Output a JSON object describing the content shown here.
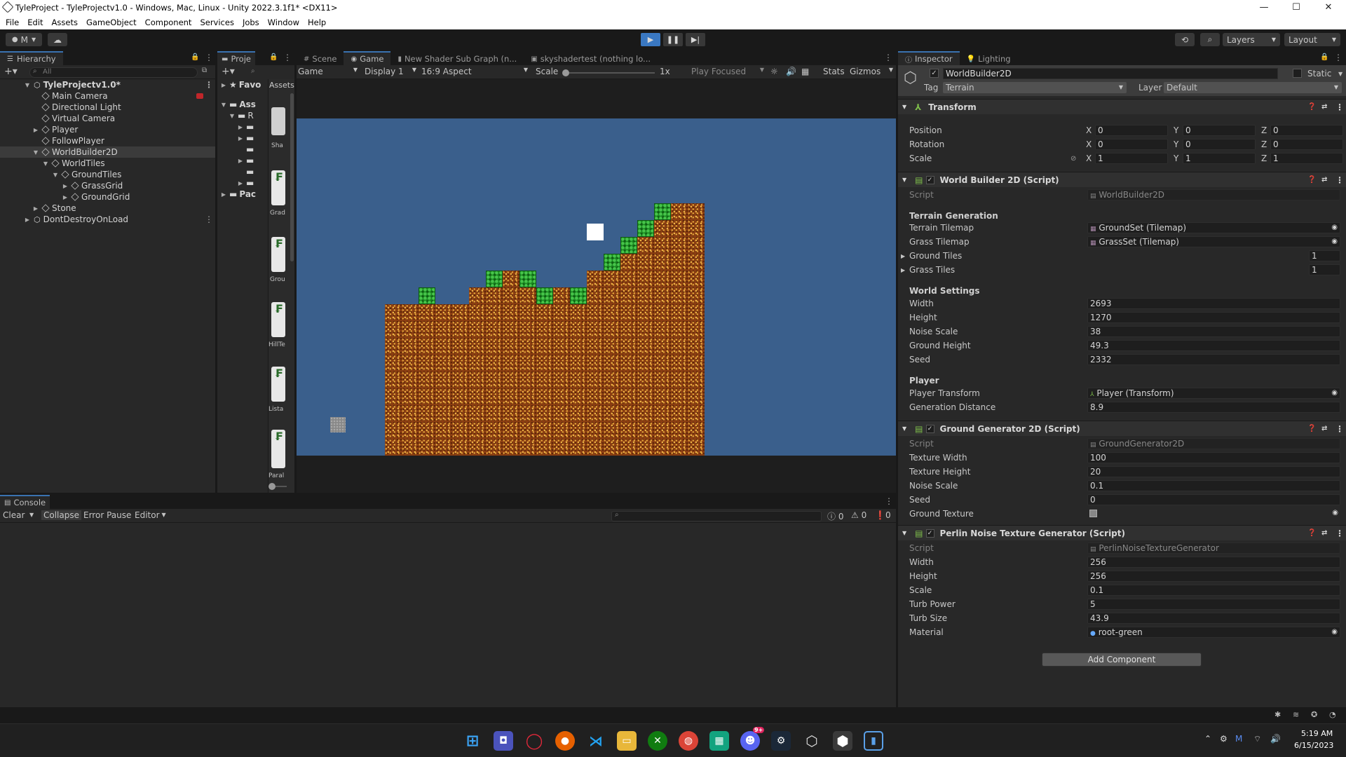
{
  "window": {
    "title": "TyleProject - TyleProjectv1.0 - Windows, Mac, Linux - Unity 2022.3.1f1* <DX11>",
    "min": "—",
    "max": "☐",
    "close": "✕"
  },
  "menu": [
    "File",
    "Edit",
    "Assets",
    "GameObject",
    "Component",
    "Services",
    "Jobs",
    "Window",
    "Help"
  ],
  "toolbar": {
    "account": "M",
    "layers": "Layers",
    "layout": "Layout"
  },
  "hierarchy": {
    "tab": "Hierarchy",
    "search_placeholder": "All",
    "items": [
      {
        "label": "TyleProjectv1.0*",
        "bold": true
      },
      {
        "label": "Main Camera"
      },
      {
        "label": "Directional Light"
      },
      {
        "label": "Virtual Camera"
      },
      {
        "label": "Player"
      },
      {
        "label": "FollowPlayer"
      },
      {
        "label": "WorldBuilder2D"
      },
      {
        "label": "WorldTiles"
      },
      {
        "label": "GroundTiles"
      },
      {
        "label": "GrassGrid"
      },
      {
        "label": "GroundGrid"
      },
      {
        "label": "Stone"
      },
      {
        "label": "DontDestroyOnLoad"
      }
    ]
  },
  "project": {
    "tab": "Proje",
    "favorites": "Favo",
    "assets": "Ass",
    "root": "R",
    "packages": "Pac",
    "assets_header": "Assets",
    "thumbs": [
      "Sha",
      "Grad",
      "Grou",
      "HillTe",
      "Lista",
      "Paral"
    ]
  },
  "game_view": {
    "tabs": [
      "Scene",
      "Game",
      "New Shader Sub Graph (n...",
      "skyshadertest (nothing lo..."
    ],
    "game_dropdown": "Game",
    "display": "Display 1",
    "aspect": "16:9 Aspect",
    "scale_label": "Scale",
    "scale_value": "1x",
    "play_mode": "Play Focused",
    "stats": "Stats",
    "gizmos": "Gizmos",
    "colors": {
      "sky": "#3a5f8c",
      "dirt": "#8b3e12",
      "grass": "#1c8a22"
    }
  },
  "console": {
    "tab": "Console",
    "clear": "Clear",
    "collapse": "Collapse",
    "error_pause": "Error Pause",
    "editor": "Editor",
    "log_count": "0",
    "warn_count": "0",
    "error_count": "0"
  },
  "inspector": {
    "tabs": [
      "Inspector",
      "Lighting"
    ],
    "object_name": "WorldBuilder2D",
    "static": "Static",
    "tag_label": "Tag",
    "tag_value": "Terrain",
    "layer_label": "Layer",
    "layer_value": "Default",
    "transform": {
      "title": "Transform",
      "position": {
        "label": "Position",
        "x": "0",
        "y": "0",
        "z": "0"
      },
      "rotation": {
        "label": "Rotation",
        "x": "0",
        "y": "0",
        "z": "0"
      },
      "scale": {
        "label": "Scale",
        "x": "1",
        "y": "1",
        "z": "1"
      }
    },
    "world_builder": {
      "title": "World Builder 2D (Script)",
      "script_label": "Script",
      "script_value": "WorldBuilder2D",
      "terrain_section": "Terrain Generation",
      "terrain_tilemap_label": "Terrain Tilemap",
      "terrain_tilemap_value": "GroundSet (Tilemap)",
      "grass_tilemap_label": "Grass Tilemap",
      "grass_tilemap_value": "GrassSet (Tilemap)",
      "ground_tiles_label": "Ground Tiles",
      "ground_tiles_value": "1",
      "grass_tiles_label": "Grass Tiles",
      "grass_tiles_value": "1",
      "world_section": "World Settings",
      "width_label": "Width",
      "width_value": "2693",
      "height_label": "Height",
      "height_value": "1270",
      "noise_label": "Noise Scale",
      "noise_value": "38",
      "ground_height_label": "Ground Height",
      "ground_height_value": "49.3",
      "seed_label": "Seed",
      "seed_value": "2332",
      "player_section": "Player",
      "player_transform_label": "Player Transform",
      "player_transform_value": "Player (Transform)",
      "gen_distance_label": "Generation Distance",
      "gen_distance_value": "8.9"
    },
    "ground_generator": {
      "title": "Ground Generator 2D (Script)",
      "script_label": "Script",
      "script_value": "GroundGenerator2D",
      "tex_width_label": "Texture Width",
      "tex_width_value": "100",
      "tex_height_label": "Texture Height",
      "tex_height_value": "20",
      "noise_label": "Noise Scale",
      "noise_value": "0.1",
      "seed_label": "Seed",
      "seed_value": "0",
      "ground_tex_label": "Ground Texture"
    },
    "perlin": {
      "title": "Perlin Noise Texture Generator (Script)",
      "script_label": "Script",
      "script_value": "PerlinNoiseTextureGenerator",
      "width_label": "Width",
      "width_value": "256",
      "height_label": "Height",
      "height_value": "256",
      "scale_label": "Scale",
      "scale_value": "0.1",
      "turb_power_label": "Turb Power",
      "turb_power_value": "5",
      "turb_size_label": "Turb Size",
      "turb_size_value": "43.9",
      "material_label": "Material",
      "material_value": "root-green"
    },
    "add_component": "Add Component"
  },
  "taskbar": {
    "time": "5:19 AM",
    "date": "6/15/2023",
    "discord_badge": "9+"
  }
}
